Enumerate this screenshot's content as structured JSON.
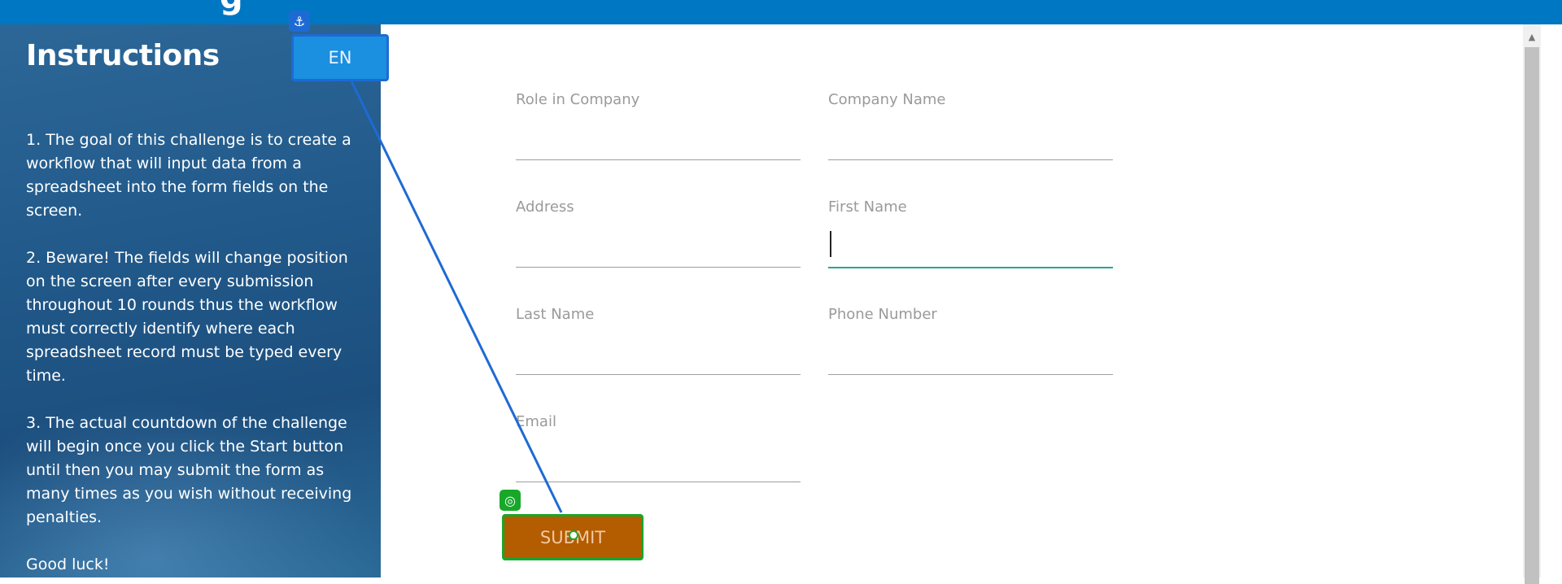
{
  "header": {
    "title_fragment": "g"
  },
  "sidebar": {
    "title": "Instructions",
    "paragraphs": [
      "1. The goal of this challenge is to create a workflow that will input data from a spreadsheet into the form fields on the screen.",
      "2. Beware! The fields will change position on the screen after every submission throughout 10 rounds thus the workflow must correctly identify where each spreadsheet record must be typed every time.",
      "3. The actual countdown of the challenge will begin once you click the Start button until then you may submit the form as many times as you wish without receiving penalties.",
      "Good luck!"
    ]
  },
  "language_button": {
    "label": "EN"
  },
  "form": {
    "fields": {
      "role": {
        "label": "Role in Company",
        "value": ""
      },
      "company": {
        "label": "Company Name",
        "value": ""
      },
      "address": {
        "label": "Address",
        "value": ""
      },
      "first_name": {
        "label": "First Name",
        "value": ""
      },
      "last_name": {
        "label": "Last Name",
        "value": ""
      },
      "phone": {
        "label": "Phone Number",
        "value": ""
      },
      "email": {
        "label": "Email",
        "value": ""
      }
    },
    "submit_label": "SUBMIT"
  },
  "icons": {
    "anchor": "anchor-icon",
    "target": "target-icon",
    "scroll_up": "scroll-up-arrow-icon"
  },
  "colors": {
    "header": "#0077c2",
    "sidebar": "#21598a",
    "language_button": "#1b8fe0",
    "submit_button": "#b35c00",
    "focus_underline": "#26a69a",
    "connector": "#1e6ad4",
    "target_outline": "#17a82a"
  }
}
